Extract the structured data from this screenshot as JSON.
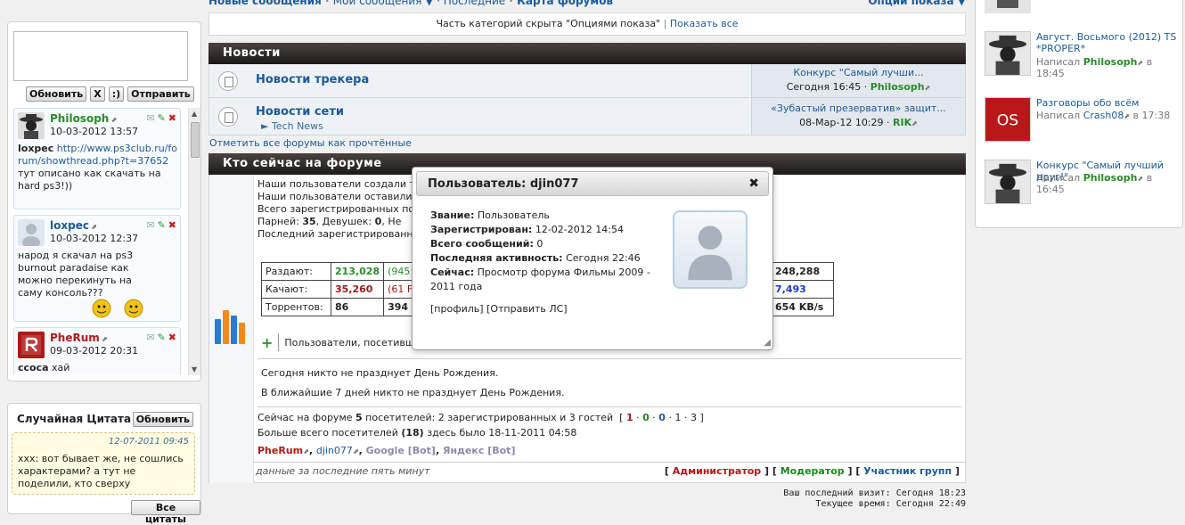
{
  "shoutbox": {
    "buttons": {
      "refresh": "Обновить",
      "clear": "X",
      "smile": ":)",
      "send": "Отправить"
    },
    "messages": [
      {
        "user": "Philosoph",
        "date": "10-03-2012 13:57",
        "author": "loxpec",
        "link": "http://www.ps3club.ru/forum/showthread.php?t=37652",
        "text": "тут описано как скачать на hard ps3!))"
      },
      {
        "user": "loxpec",
        "date": "10-03-2012 12:37",
        "text": "народ я скачал на ps3 burnout paradaise как можно перекинуть на саму консоль???"
      },
      {
        "user": "PheRum",
        "date": "09-03-2012 20:31",
        "text_bold": "ccoca",
        "text": "хай"
      }
    ]
  },
  "quote": {
    "title": "Случайная Цитата",
    "refresh": "Обновить",
    "date": "12-07-2011 09:45",
    "text": "xxx: вот бывает же, не сошлись характерами? а тут не поделили, кто сверху",
    "all": "Все цитаты"
  },
  "nav": {
    "new_posts": "Новые сообщения",
    "latest": "Мои сообщения ▼ · Последние",
    "map": "Карта форумов",
    "options": "Опции показа ▼"
  },
  "hidden_bar": {
    "text": "Часть категорий скрыта \"Опциями показа\"",
    "show_all": "Показать все"
  },
  "news": {
    "header": "Новости",
    "forums": [
      {
        "title": "Новости трекера",
        "sub": "",
        "last_title": "Конкурс \"Самый лучши...",
        "last_date": "Сегодня 16:45",
        "last_user": "Philosoph"
      },
      {
        "title": "Новости сети",
        "sub": "► Tech News",
        "last_title": "«Зубастый презерватив» защит...",
        "last_date": "08-Мар-12 10:29",
        "last_user": "RIK"
      }
    ],
    "mark_read": "Отметить все форумы как прочтённые"
  },
  "online": {
    "header": "Кто сейчас на форуме",
    "lines": [
      "Наши пользователи создали т",
      "Наши пользователи оставили",
      "Всего зарегистрированных пол",
      "Последний зарегистрированн"
    ],
    "gender_line": {
      "boys_label": "Парней:",
      "boys": "35",
      "girls_label": "Девушек:",
      "girls": "0",
      "rest": "Не"
    },
    "stats": {
      "rows": [
        {
          "label": "Раздают:",
          "v1": "213,028",
          "v2": "(945",
          "v3": "248,288"
        },
        {
          "label": "Качают:",
          "v1": "35,260",
          "v2": "(61 F",
          "v3": "7,493"
        },
        {
          "label": "Торрентов:",
          "v1": "86",
          "v2": "394",
          "v3": "654 KB/s"
        }
      ]
    },
    "users_line": "Пользователи, посетивши",
    "birthday_today": "Сегодня никто не празднует День Рождения.",
    "birthday_week": "В ближайшие 7 дней никто не празднует День Рождения.",
    "now_online": "Сейчас на форуме",
    "now_count": "5",
    "now_rest": "посетителей: 2 зарегистрированных и 3 гостей",
    "now_breakdown": [
      "1",
      "0",
      "0",
      "1",
      "3"
    ],
    "record_pre": "Больше всего посетителей",
    "record_count": "(18)",
    "record_post": "здесь было 18-11-2011 04:58",
    "users": [
      "PheRum",
      "djin077",
      "Google [Bot]",
      "Яндекс [Bot]"
    ],
    "legend_note": "данные за последние пять минут",
    "legend": {
      "admin": "Администратор",
      "mod": "Модератор",
      "group": "Участник групп"
    }
  },
  "visit": {
    "last": "Ваш последний визит: Сегодня 18:23",
    "now": "Текущее время: Сегодня 22:49"
  },
  "popup": {
    "title": "Пользователь: djin077",
    "rank_label": "Звание:",
    "rank": "Пользователь",
    "reg_label": "Зарегистрирован:",
    "reg": "12-02-2012 14:54",
    "posts_label": "Всего сообщений:",
    "posts": "0",
    "activity_label": "Последняя активность:",
    "activity": "Сегодня 22:46",
    "now_label": "Сейчас:",
    "now": "Просмотр форума Фильмы 2009 - 2011 года",
    "profile": "[профиль]",
    "pm": "[Отправить ЛС]"
  },
  "right_panel": {
    "items": [
      {
        "title": "Август. Восьмого (2012) TS *PROPER*",
        "by": "Написал",
        "user": "Philosoph",
        "time": "в 18:45"
      },
      {
        "title": "Разговоры обо всём",
        "by": "Написал",
        "user": "Crash08",
        "time": "в 17:38"
      },
      {
        "title": "Конкурс \"Самый лучший друг!\"",
        "by": "Написал",
        "user": "Philosoph",
        "time": "в 16:45"
      }
    ]
  },
  "colors": {
    "admin": "#b01818",
    "mod": "#1a8a1a",
    "link": "#1a5a9a",
    "header": "#2a2422"
  }
}
